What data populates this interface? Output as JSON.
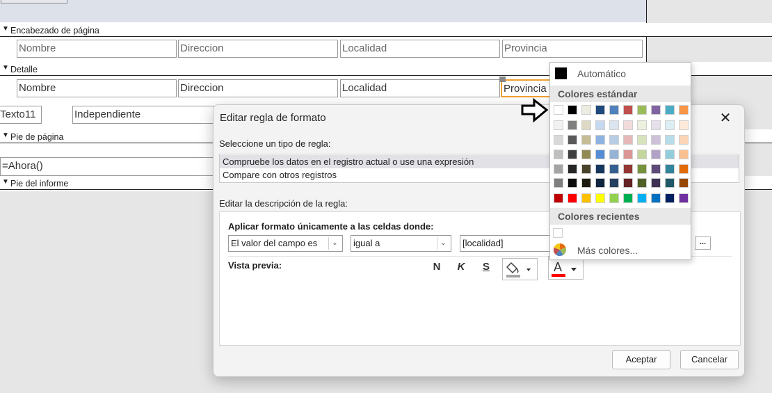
{
  "report": {
    "sections": {
      "page_header": "Encabezado de página",
      "detail": "Detalle",
      "page_footer": "Pie de página",
      "report_footer": "Pie del informe"
    },
    "header_fields": [
      "Nombre",
      "Direccion",
      "Localidad",
      "Provincia"
    ],
    "detail_fields": [
      "Nombre",
      "Direccion",
      "Localidad",
      "Provincia"
    ],
    "texto_label": "Texto11",
    "texto_value": "Independiente",
    "now_expr": "=Ahora()"
  },
  "dialog": {
    "title": "Editar regla de formato",
    "close": "✕",
    "select_rule_label": "Seleccione un tipo de regla:",
    "rule_types": [
      "Compruebe los datos en el registro actual o use una expresión",
      "Compare con otros registros"
    ],
    "edit_desc_label": "Editar la descripción de la regla:",
    "apply_label": "Aplicar formato únicamente a las celdas donde:",
    "condition_field": "El valor del campo es",
    "condition_op": "igual a",
    "condition_value": "[localidad]",
    "ellipsis": "...",
    "preview_label": "Vista previa:",
    "bold_btn": "N",
    "italic_btn": "K",
    "underline_btn": "S",
    "accept": "Aceptar",
    "cancel": "Cancelar"
  },
  "color_popup": {
    "automatic": "Automático",
    "standard_colors": "Colores estándar",
    "recent_colors": "Colores recientes",
    "more_colors": "Más colores...",
    "theme_rows": [
      [
        "#ffffff",
        "#000000",
        "#eeece1",
        "#1f497d",
        "#4f81bd",
        "#c0504d",
        "#9bbb59",
        "#8064a2",
        "#4bacc6",
        "#f79646"
      ],
      [
        "#f2f2f2",
        "#7f7f7f",
        "#ddd9c3",
        "#c6d9f0",
        "#dbe5f1",
        "#f2dcdb",
        "#ebf1dd",
        "#e5e0ec",
        "#dbeef3",
        "#fdeada"
      ],
      [
        "#d8d8d8",
        "#595959",
        "#c4bd97",
        "#8db3e2",
        "#b8cce4",
        "#e5b9b7",
        "#d7e3bc",
        "#ccc1d9",
        "#b7dde8",
        "#fbd5b5"
      ],
      [
        "#bfbfbf",
        "#3f3f3f",
        "#938953",
        "#548dd4",
        "#95b3d7",
        "#d99694",
        "#c3d69b",
        "#b2a2c7",
        "#92cddc",
        "#fac08f"
      ],
      [
        "#a5a5a5",
        "#262626",
        "#494429",
        "#17365d",
        "#366092",
        "#953734",
        "#76923c",
        "#5f497a",
        "#31859b",
        "#e36c09"
      ],
      [
        "#7f7f7f",
        "#0c0c0c",
        "#1d1b10",
        "#0f243e",
        "#244061",
        "#632423",
        "#4f6128",
        "#3f3151",
        "#205867",
        "#974806"
      ]
    ],
    "standard_row": [
      "#c00000",
      "#ff0000",
      "#ffc000",
      "#ffff00",
      "#92d050",
      "#00b050",
      "#00b0f0",
      "#0070c0",
      "#002060",
      "#7030a0"
    ]
  }
}
